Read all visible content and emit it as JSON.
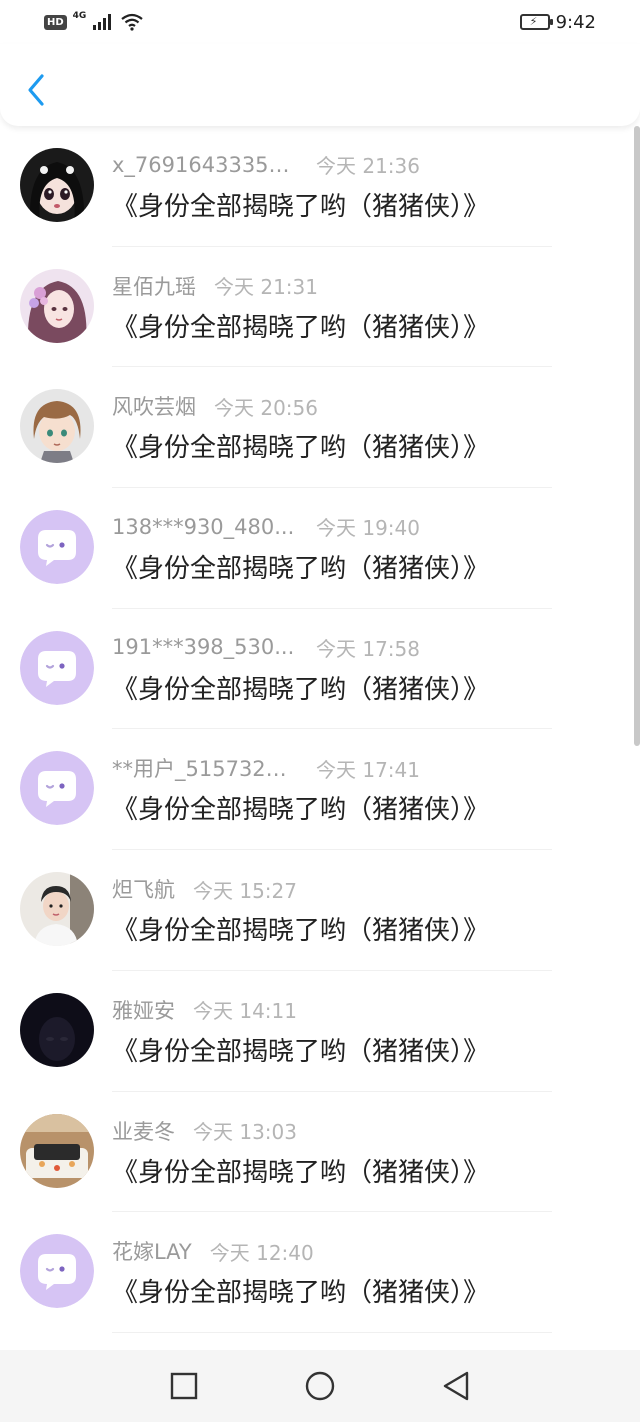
{
  "status_bar": {
    "hd": "HD",
    "network": "4G",
    "time": "9:42"
  },
  "header": {
    "back_icon": "chevron-left-icon",
    "accent_color": "#1e9bf0"
  },
  "items": [
    {
      "name": "x_76916433356...",
      "time": "今天 21:36",
      "message": "《身份全部揭晓了哟（猪猪侠）》",
      "avatar": "anime-girl-dark-hair-avatar"
    },
    {
      "name": "星佰九瑶",
      "time": "今天 21:31",
      "message": "《身份全部揭晓了哟（猪猪侠）》",
      "avatar": "anime-girl-flowers-avatar"
    },
    {
      "name": "风吹芸烟",
      "time": "今天 20:56",
      "message": "《身份全部揭晓了哟（猪猪侠）》",
      "avatar": "anime-boy-brown-hair-avatar"
    },
    {
      "name": "138***930_480...",
      "time": "今天 19:40",
      "message": "《身份全部揭晓了哟（猪猪侠）》",
      "avatar": "default-chat-bubble-avatar"
    },
    {
      "name": "191***398_530...",
      "time": "今天 17:58",
      "message": "《身份全部揭晓了哟（猪猪侠）》",
      "avatar": "default-chat-bubble-avatar"
    },
    {
      "name": "**用户_5157323...",
      "time": "今天 17:41",
      "message": "《身份全部揭晓了哟（猪猪侠）》",
      "avatar": "default-chat-bubble-avatar"
    },
    {
      "name": "炟飞航",
      "time": "今天 15:27",
      "message": "《身份全部揭晓了哟（猪猪侠）》",
      "avatar": "child-photo-avatar"
    },
    {
      "name": "雅娅安",
      "time": "今天 14:11",
      "message": "《身份全部揭晓了哟（猪猪侠）》",
      "avatar": "dark-photo-avatar"
    },
    {
      "name": "业麦冬",
      "time": "今天 13:03",
      "message": "《身份全部揭晓了哟（猪猪侠）》",
      "avatar": "sushi-photo-avatar"
    },
    {
      "name": "花嫁LAY",
      "time": "今天 12:40",
      "message": "《身份全部揭晓了哟（猪猪侠）》",
      "avatar": "default-chat-bubble-avatar"
    }
  ],
  "nav": {
    "recent": "square-icon",
    "home": "circle-icon",
    "back": "triangle-back-icon"
  }
}
